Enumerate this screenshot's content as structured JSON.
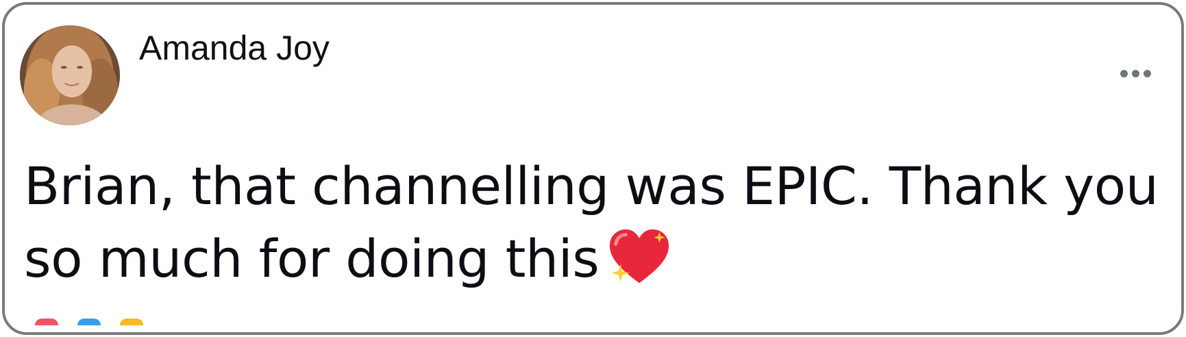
{
  "comment": {
    "author": "Amanda Joy",
    "text": "Brian, that channelling was EPIC. Thank you so much for doing this",
    "emoji": "sparkling-heart-icon",
    "more_icon": "more-options-icon"
  },
  "colors": {
    "border": "#7a7a7a",
    "text": "#0d0d14",
    "more_dots": "#70757c",
    "heart": "#e8283a",
    "sparkle": "#ffcf3a"
  },
  "reaction_colors": [
    "#f0555f",
    "#3b9de8",
    "#f7b928"
  ]
}
